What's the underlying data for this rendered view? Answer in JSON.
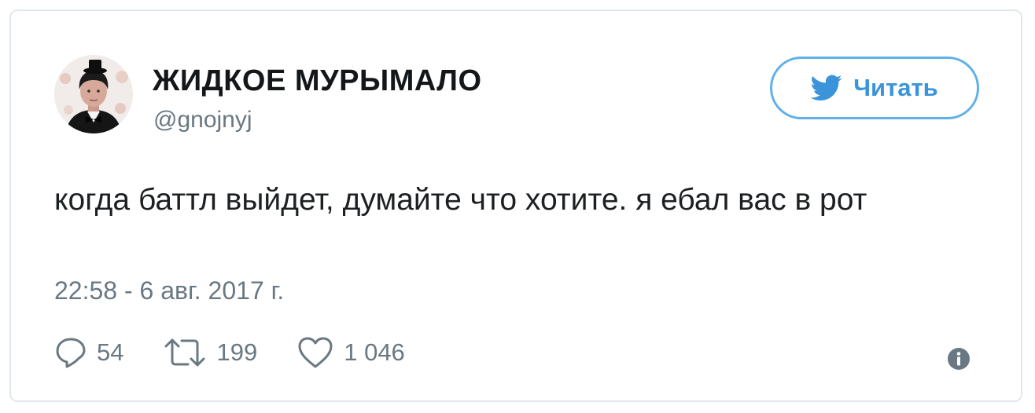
{
  "tweet": {
    "display_name": "ЖИДКОЕ МУРЫМАЛО",
    "handle": "@gnojnyj",
    "text": "когда баттл выйдет, думайте что хотите. я ебал вас в рот",
    "timestamp": "22:58 - 6 авг. 2017 г."
  },
  "follow_button": {
    "label": "Читать",
    "icon": "twitter-bird-icon",
    "color": "#3b94d9"
  },
  "actions": {
    "replies": {
      "icon": "reply-icon",
      "count": "54"
    },
    "retweets": {
      "icon": "retweet-icon",
      "count": "199"
    },
    "likes": {
      "icon": "heart-icon",
      "count": "1 046"
    },
    "info": {
      "icon": "info-icon"
    }
  },
  "colors": {
    "text": "#1c2022",
    "secondary_text": "#697882",
    "border": "#e1e8ed",
    "accent": "#3b94d9"
  }
}
